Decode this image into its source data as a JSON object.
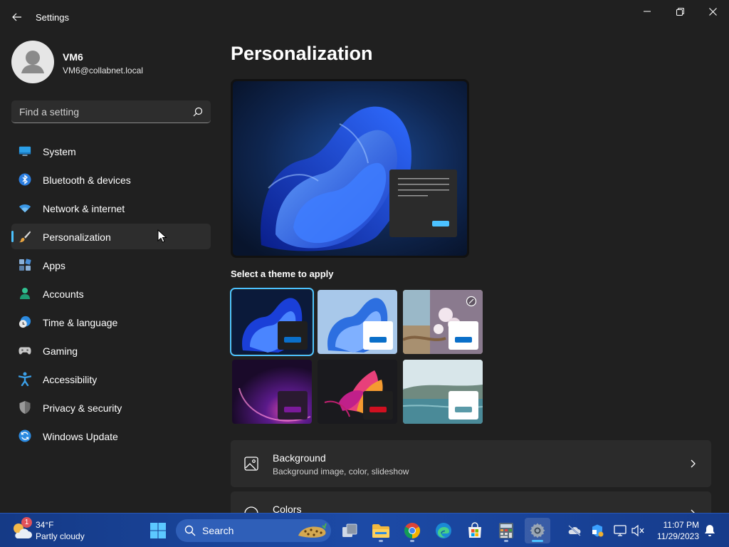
{
  "window": {
    "title": "Settings"
  },
  "profile": {
    "name": "VM6",
    "email": "VM6@collabnet.local"
  },
  "search": {
    "placeholder": "Find a setting"
  },
  "sidebar": {
    "items": [
      {
        "label": "System",
        "icon": "monitor-icon",
        "active": false
      },
      {
        "label": "Bluetooth & devices",
        "icon": "bluetooth-icon",
        "active": false
      },
      {
        "label": "Network & internet",
        "icon": "wifi-icon",
        "active": false
      },
      {
        "label": "Personalization",
        "icon": "brush-icon",
        "active": true
      },
      {
        "label": "Apps",
        "icon": "apps-icon",
        "active": false
      },
      {
        "label": "Accounts",
        "icon": "person-icon",
        "active": false
      },
      {
        "label": "Time & language",
        "icon": "clock-globe-icon",
        "active": false
      },
      {
        "label": "Gaming",
        "icon": "gamepad-icon",
        "active": false
      },
      {
        "label": "Accessibility",
        "icon": "accessibility-icon",
        "active": false
      },
      {
        "label": "Privacy & security",
        "icon": "shield-icon",
        "active": false
      },
      {
        "label": "Windows Update",
        "icon": "update-icon",
        "active": false
      }
    ]
  },
  "main": {
    "title": "Personalization",
    "themes_label": "Select a theme to apply",
    "themes": [
      {
        "name": "windows-dark",
        "selected": true
      },
      {
        "name": "windows-light",
        "selected": false
      },
      {
        "name": "windows-spotlight",
        "selected": false
      },
      {
        "name": "glow",
        "selected": false
      },
      {
        "name": "captured-motion",
        "selected": false
      },
      {
        "name": "flow",
        "selected": false
      }
    ],
    "cards": [
      {
        "title": "Background",
        "description": "Background image, color, slideshow"
      },
      {
        "title": "Colors",
        "description": ""
      }
    ]
  },
  "taskbar": {
    "weather": {
      "temp": "34°F",
      "desc": "Partly cloudy",
      "badge": "1"
    },
    "search_label": "Search",
    "clock": {
      "time": "11:07 PM",
      "date": "11/29/2023"
    }
  },
  "colors": {
    "accent": "#4cc2ff",
    "window_bg": "#202020",
    "card_bg": "#2b2b2b",
    "taskbar_bg": "#1c4aa6"
  }
}
